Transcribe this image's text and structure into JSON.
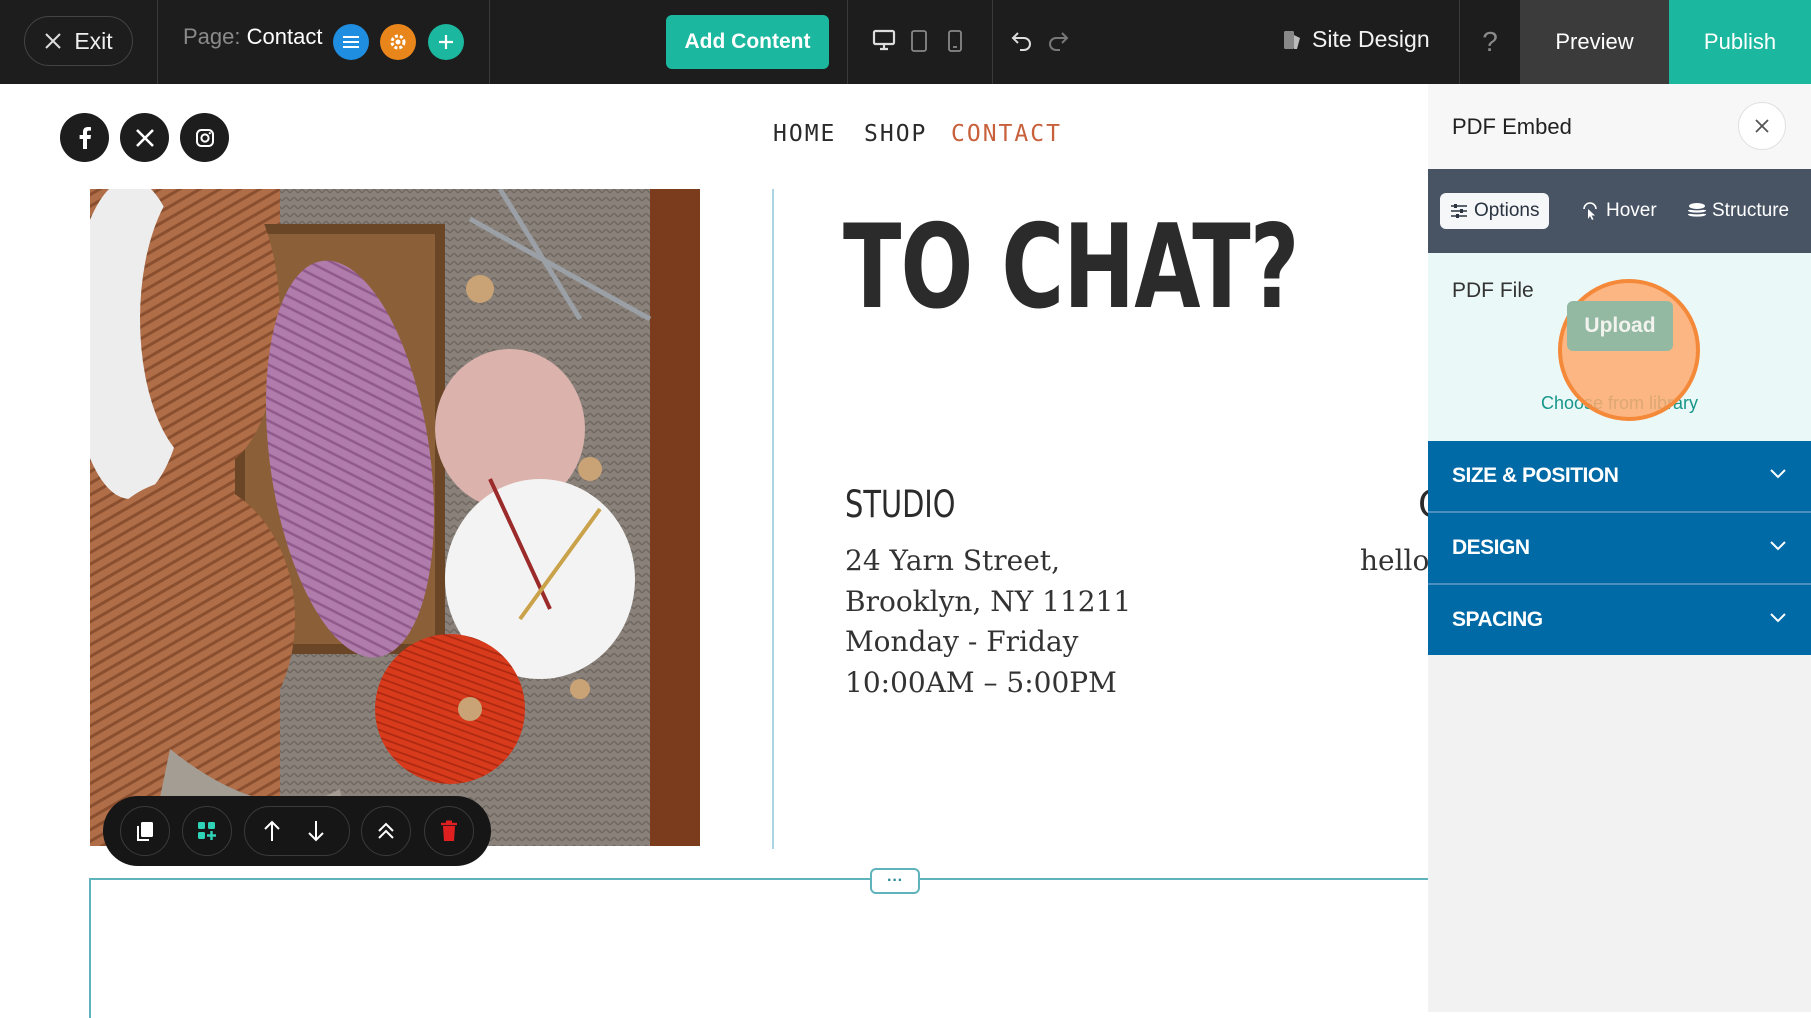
{
  "toolbar": {
    "exit_label": "Exit",
    "page_prefix": "Page:",
    "page_name": "Contact",
    "add_content_label": "Add Content",
    "site_design_label": "Site Design",
    "help_label": "?",
    "preview_label": "Preview",
    "publish_label": "Publish",
    "accent_color": "#1bb79e",
    "icons": [
      "close-icon",
      "list-icon",
      "gear-icon",
      "plus-icon",
      "desktop-icon",
      "tablet-icon",
      "mobile-icon",
      "undo-icon",
      "redo-icon",
      "site-design-icon"
    ]
  },
  "site": {
    "social": [
      "facebook-icon",
      "x-icon",
      "instagram-icon"
    ],
    "nav": {
      "home": "HOME",
      "shop": "SHOP",
      "contact": "CONTACT"
    },
    "nav_active_color": "#c8603b",
    "headline": "TO CHAT?",
    "studio_heading": "STUDIO",
    "address_lines": [
      "24 Yarn Street,",
      "Brooklyn, NY 11211",
      "Monday - Friday",
      "10:00AM – 5:00PM"
    ],
    "cut_heading": "C",
    "cut_text": "hello",
    "section_handle": "···"
  },
  "element_toolbar": {
    "icons": [
      "copy-icon",
      "add-widget-icon",
      "arrow-up-icon",
      "arrow-down-icon",
      "collapse-up-icon",
      "trash-icon"
    ]
  },
  "panel": {
    "title": "PDF Embed",
    "tabs": {
      "options": "Options",
      "hover": "Hover",
      "structure": "Structure"
    },
    "active_tab": "Options",
    "pdf_file_label": "PDF File",
    "upload_label": "Upload",
    "choose_library_label": "Choose from library",
    "sections": {
      "size_position": "SIZE & POSITION",
      "design": "DESIGN",
      "spacing": "SPACING"
    },
    "section_color": "#006aa6"
  }
}
